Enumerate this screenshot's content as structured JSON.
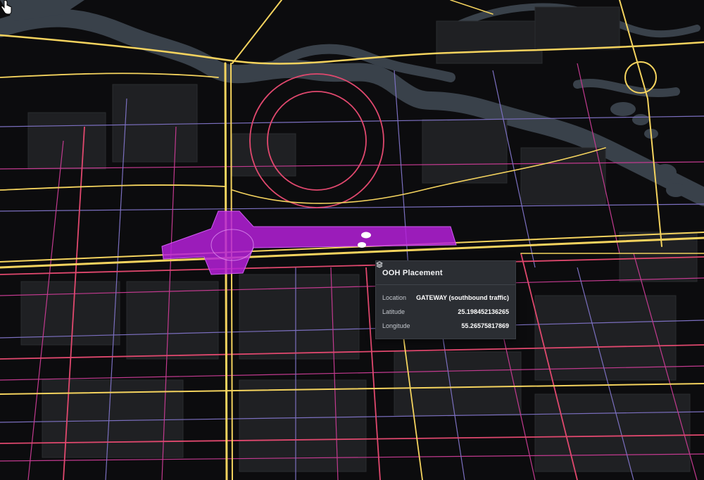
{
  "map": {
    "highlight_color": "#b520d8",
    "road_colors": [
      "#f4d35e",
      "#e0486e",
      "#c23a8f",
      "#7b6fbf"
    ],
    "water_color": "#3a4149",
    "building_color": "#222326",
    "markers": [
      "placement-marker-a",
      "placement-marker-b"
    ]
  },
  "tooltip": {
    "icon": "layers-icon",
    "title": "OOH Placement",
    "rows": [
      {
        "label": "Location",
        "value": "GATEWAY (southbound traffic)"
      },
      {
        "label": "Latitude",
        "value": "25.198452136265"
      },
      {
        "label": "Longitude",
        "value": "55.26575817869"
      }
    ]
  },
  "cursor": {
    "icon": "hand-pointer-icon"
  }
}
